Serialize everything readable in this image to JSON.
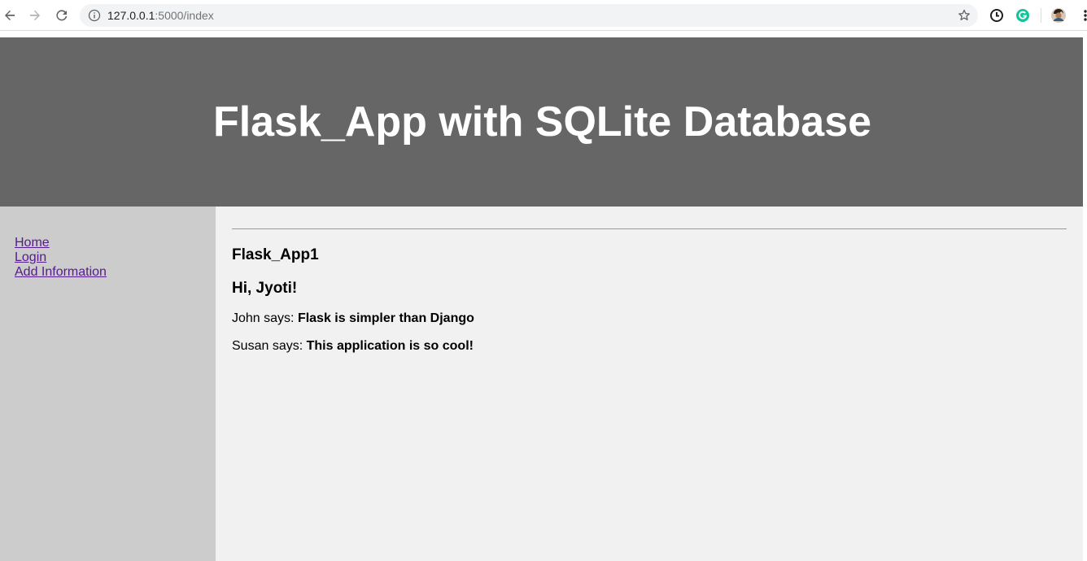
{
  "browser": {
    "url_host": "127.0.0.1",
    "url_path": ":5000/index",
    "icons": [
      "back-icon",
      "forward-icon",
      "reload-icon",
      "info-icon",
      "star-icon",
      "timer-extension-icon",
      "grammarly-icon",
      "profile-avatar",
      "menu-icon"
    ]
  },
  "header": {
    "title": "Flask_App with SQLite Database"
  },
  "sidebar": {
    "links": [
      {
        "label": "Home"
      },
      {
        "label": "Login"
      },
      {
        "label": "Add Information"
      }
    ]
  },
  "main": {
    "app_name": "Flask_App1",
    "greeting": "Hi, Jyoti!",
    "posts": [
      {
        "author": "John says:",
        "body": "Flask is simpler than Django"
      },
      {
        "author": "Susan says:",
        "body": "This application is so cool!"
      }
    ]
  },
  "colors": {
    "header_bg": "#666666",
    "sidebar_bg": "#cccccc",
    "content_bg": "#f1f1f1",
    "link_visited": "#551a8b",
    "grammarly": "#15c39a"
  }
}
